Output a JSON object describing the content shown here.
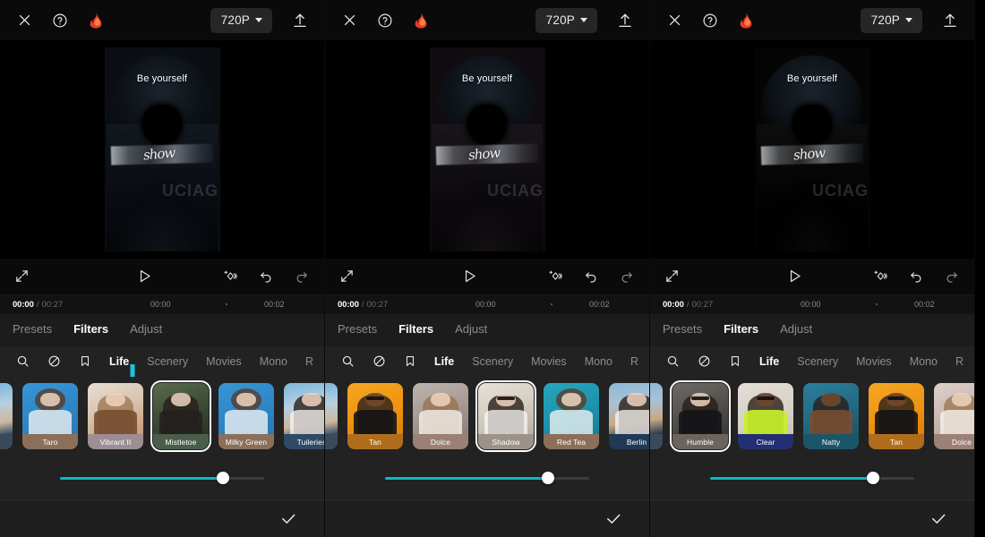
{
  "app": {
    "topbar": {
      "close_icon": "close-x-icon",
      "help_icon": "help-circle-icon",
      "flame_icon": "flame-icon",
      "resolution_label": "720P",
      "export_icon": "upload-export-icon"
    },
    "preview": {
      "caption": "Be yourself",
      "overlay_text": "show",
      "brand_text": "UCIAG"
    },
    "player": {
      "fullscreen_icon": "fullscreen-expand-icon",
      "play_icon": "play-triangle-icon",
      "keyframe_icon": "add-keyframe-icon",
      "undo_icon": "undo-arrow-icon",
      "redo_icon": "redo-arrow-icon"
    },
    "timeline": {
      "current_time": "00:00",
      "separator": "/",
      "total_time": "00:27",
      "ruler_marks": [
        "00:00",
        "00:02"
      ]
    },
    "tabs": [
      {
        "label": "Presets",
        "active": true,
        "bold": false
      },
      {
        "label": "Filters",
        "active": false,
        "bold": true
      },
      {
        "label": "Adjust",
        "active": false,
        "bold": false
      }
    ],
    "categories": {
      "search_icon": "search-magnifier-icon",
      "none_icon": "no-filter-slash-icon",
      "bookmark_icon": "bookmark-saved-icon",
      "items": [
        {
          "label": "Life",
          "active": true
        },
        {
          "label": "Scenery",
          "active": false
        },
        {
          "label": "Movies",
          "active": false
        },
        {
          "label": "Mono",
          "active": false
        },
        {
          "label": "R",
          "active": false
        }
      ]
    },
    "annotation": {
      "arrow_icon": "down-arrow-annotation",
      "color": "#1ac6d9"
    },
    "slider": {
      "value_percent": 80,
      "fill_color": "#11b6c4"
    },
    "confirm": {
      "check_icon": "confirm-check-icon"
    }
  },
  "panels": [
    {
      "id": "panel-1",
      "tint": "",
      "selected_filter": "Mistletoe",
      "filters": [
        {
          "name": "Taro",
          "swatch": "p-blue",
          "bar": "#8c6f59",
          "hair": "hair",
          "face": "face",
          "torso": "torso",
          "shades": false
        },
        {
          "name": "Vibrant II",
          "swatch": "p-peach",
          "bar": "#9c8e93",
          "hair": "hair-blonde",
          "face": "face",
          "torso": "torso skin",
          "shades": false
        },
        {
          "name": "Mistletoe",
          "swatch": "p-green",
          "bar": "#4a5d4a",
          "hair": "hair2",
          "face": "face",
          "torso": "torso dk",
          "shades": false
        },
        {
          "name": "Milky Green",
          "swatch": "p-blue",
          "bar": "#8c6f59",
          "hair": "hair",
          "face": "face",
          "torso": "torso",
          "shades": false
        },
        {
          "name": "Tuileries",
          "swatch": "p-sky",
          "bar": "#2e4a64",
          "hair": "hair2",
          "face": "face",
          "torso": "torso",
          "shades": false
        }
      ]
    },
    {
      "id": "panel-2",
      "tint": "tint-shadow",
      "selected_filter": "Shadow",
      "filters": [
        {
          "name": "Tan",
          "swatch": "p-orange",
          "bar": "#b06d1c",
          "hair": "hair2",
          "face": "face dk",
          "torso": "torso blk",
          "shades": true
        },
        {
          "name": "Dolce",
          "swatch": "p-gray",
          "bar": "#9c8075",
          "hair": "hair-blonde",
          "face": "face",
          "torso": "torso",
          "shades": false
        },
        {
          "name": "Shadow",
          "swatch": "p-beige",
          "bar": "#9c9289",
          "hair": "hair2",
          "face": "face",
          "torso": "torso",
          "shades": true
        },
        {
          "name": "Red Tea",
          "swatch": "p-teal",
          "bar": "#8c6f59",
          "hair": "hair",
          "face": "face",
          "torso": "torso",
          "shades": false
        },
        {
          "name": "Berlin",
          "swatch": "p-navy",
          "bar": "#1f3a56",
          "hair": "hair2",
          "face": "face",
          "torso": "torso",
          "shades": false
        }
      ]
    },
    {
      "id": "panel-3",
      "tint": "tint-humble",
      "selected_filter": "Humble",
      "filters": [
        {
          "name": "Humble",
          "swatch": "p-dkgray",
          "bar": "#6b645e",
          "hair": "hair2",
          "face": "face",
          "torso": "torso blk",
          "shades": true
        },
        {
          "name": "Clear",
          "swatch": "p-lime",
          "bar": "#232f73",
          "hair": "hair2",
          "face": "face dk",
          "torso": "torso lime",
          "shades": true
        },
        {
          "name": "Natty",
          "swatch": "p-dkteal",
          "bar": "#1b5668",
          "hair": "hair2",
          "face": "face dk",
          "torso": "torso skin",
          "shades": false
        },
        {
          "name": "Tan",
          "swatch": "p-orange",
          "bar": "#b06d1c",
          "hair": "hair2",
          "face": "face dk",
          "torso": "torso blk",
          "shades": true
        },
        {
          "name": "Dolce",
          "swatch": "p-pink",
          "bar": "#9c8075",
          "hair": "hair-blonde",
          "face": "face",
          "torso": "torso",
          "shades": false
        }
      ]
    }
  ]
}
